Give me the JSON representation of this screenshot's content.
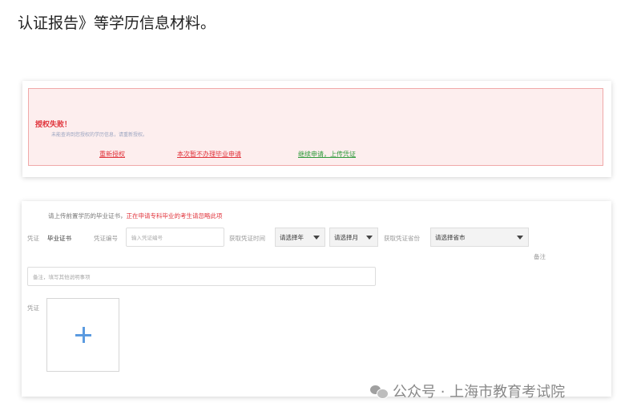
{
  "heading": {
    "text": "认证报告》等学历信息材料。"
  },
  "alert": {
    "title": "授权失败！",
    "subtitle": "未能查询到您授权的学历信息，请重新授权。",
    "reauth_link": "重新授权",
    "skip_link": "本次暂不办理毕业申请",
    "continue_link": "继续申请，上传凭证"
  },
  "form": {
    "notice_prefix": "请上传前置学历的毕业证书，",
    "notice_warning": "正在申请专科毕业的考生请忽略此项",
    "cert_label": "凭证",
    "cert_value": "毕业证书",
    "cert_no_label": "凭证编号",
    "cert_no_placeholder": "输入凭证编号",
    "time_label": "获取凭证时间",
    "year_select": "请选择年",
    "month_select": "请选择月",
    "province_label": "获取凭证省份",
    "province_select": "请选择省市",
    "remark_label": "备注",
    "remark_placeholder": "备注，填写其他说明事项",
    "upload_label": "凭证"
  },
  "watermark": {
    "text": "公众号 · 上海市教育考试院"
  }
}
